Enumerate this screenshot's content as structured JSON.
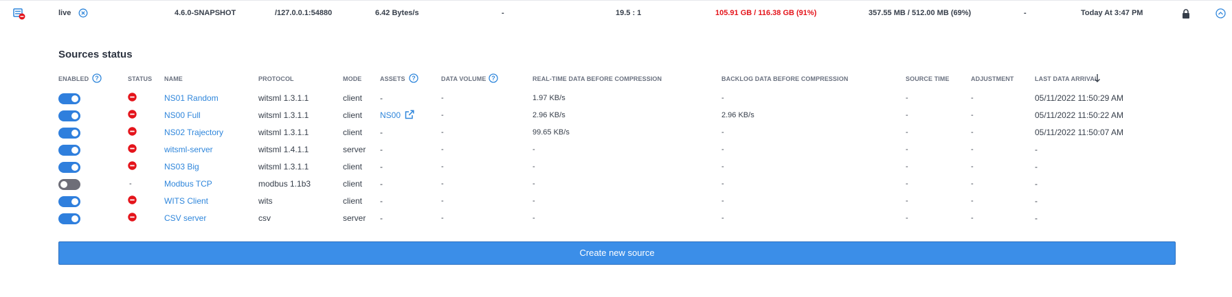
{
  "summary": {
    "name": "live",
    "version": "4.6.0-SNAPSHOT",
    "address": "/127.0.0.1:54880",
    "rate": "6.42 Bytes/s",
    "col5": "-",
    "ratio": "19.5 : 1",
    "disk": "105.91 GB / 116.38 GB (91%)",
    "memory": "357.55 MB / 512.00 MB (69%)",
    "col9": "-",
    "last_update": "Today At 3:47 PM",
    "disk_color": "#e4141b"
  },
  "sources": {
    "title": "Sources status",
    "headers": {
      "enabled": "ENABLED",
      "status": "STATUS",
      "name": "NAME",
      "protocol": "PROTOCOL",
      "mode": "MODE",
      "assets": "ASSETS",
      "data_volume": "DATA VOLUME",
      "realtime": "REAL-TIME DATA BEFORE COMPRESSION",
      "backlog": "BACKLOG DATA BEFORE COMPRESSION",
      "source_time": "SOURCE TIME",
      "adjustment": "ADJUSTMENT",
      "last_arrival": "LAST DATA ARRIVAL"
    },
    "rows": [
      {
        "enabled": true,
        "status": "error",
        "name": "NS01 Random",
        "protocol": "witsml 1.3.1.1",
        "mode": "client",
        "assets": "-",
        "volume": "-",
        "realtime": "1.97 KB/s",
        "backlog": "-",
        "source_time": "-",
        "adjustment": "-",
        "last": "05/11/2022 11:50:29 AM"
      },
      {
        "enabled": true,
        "status": "error",
        "name": "NS00 Full",
        "protocol": "witsml 1.3.1.1",
        "mode": "client",
        "assets": "NS00",
        "volume": "-",
        "realtime": "2.96 KB/s",
        "backlog": "2.96 KB/s",
        "source_time": "-",
        "adjustment": "-",
        "last": "05/11/2022 11:50:22 AM"
      },
      {
        "enabled": true,
        "status": "error",
        "name": "NS02 Trajectory",
        "protocol": "witsml 1.3.1.1",
        "mode": "client",
        "assets": "-",
        "volume": "-",
        "realtime": "99.65 KB/s",
        "backlog": "-",
        "source_time": "-",
        "adjustment": "-",
        "last": "05/11/2022 11:50:07 AM"
      },
      {
        "enabled": true,
        "status": "error",
        "name": "witsml-server",
        "protocol": "witsml 1.4.1.1",
        "mode": "server",
        "assets": "-",
        "volume": "-",
        "realtime": "-",
        "backlog": "-",
        "source_time": "-",
        "adjustment": "-",
        "last": "-"
      },
      {
        "enabled": true,
        "status": "error",
        "name": "NS03 Big",
        "protocol": "witsml 1.3.1.1",
        "mode": "client",
        "assets": "-",
        "volume": "-",
        "realtime": "-",
        "backlog": "-",
        "source_time": "-",
        "adjustment": "-",
        "last": "-"
      },
      {
        "enabled": false,
        "status": "-",
        "name": "Modbus TCP",
        "protocol": "modbus 1.1b3",
        "mode": "client",
        "assets": "-",
        "volume": "-",
        "realtime": "-",
        "backlog": "-",
        "source_time": "-",
        "adjustment": "-",
        "last": "-"
      },
      {
        "enabled": true,
        "status": "error",
        "name": "WITS Client",
        "protocol": "wits",
        "mode": "client",
        "assets": "-",
        "volume": "-",
        "realtime": "-",
        "backlog": "-",
        "source_time": "-",
        "adjustment": "-",
        "last": "-"
      },
      {
        "enabled": true,
        "status": "error",
        "name": "CSV server",
        "protocol": "csv",
        "mode": "server",
        "assets": "-",
        "volume": "-",
        "realtime": "-",
        "backlog": "-",
        "source_time": "-",
        "adjustment": "-",
        "last": "-"
      }
    ],
    "create_label": "Create new source"
  },
  "icons": {
    "server": "server-error-icon",
    "close": "close-circle-icon",
    "lock": "lock-icon",
    "collapse": "chevron-up-circle-icon",
    "help": "help-circle-icon",
    "sort": "arrow-down-icon",
    "status_error": "error-circle-icon",
    "external": "external-link-icon"
  },
  "colors": {
    "accent": "#2f86db",
    "toggle_on": "#2f7fdd",
    "toggle_off": "#6e6e78",
    "error": "#e4141b",
    "button": "#3b8ee8"
  }
}
